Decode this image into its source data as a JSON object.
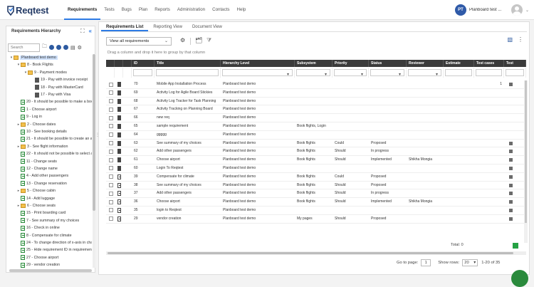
{
  "app": {
    "logo_text": "Reqtest"
  },
  "nav": [
    "Requirements",
    "Tests",
    "Bugs",
    "Plan",
    "Reports",
    "Administration",
    "Contacts",
    "Help"
  ],
  "nav_active": 0,
  "user": {
    "initials": "PT",
    "name": "Planboard test ...",
    "chevron": "⌄"
  },
  "left_panel": {
    "title": "Requirements Hierarchy",
    "search_placeholder": "Search",
    "tree": [
      {
        "depth": 0,
        "icon": "folder",
        "toggle": "▾",
        "text": "Planboard test demo",
        "selected": true
      },
      {
        "depth": 1,
        "icon": "folder",
        "toggle": "▾",
        "text": "8 - Book Flights"
      },
      {
        "depth": 2,
        "icon": "folder",
        "toggle": "▾",
        "text": "9 - Payment modes"
      },
      {
        "depth": 3,
        "icon": "doc",
        "toggle": "",
        "text": "19 - Pay with invoice receipt"
      },
      {
        "depth": 3,
        "icon": "doc",
        "toggle": "",
        "text": "18 - Pay with MasterCard"
      },
      {
        "depth": 3,
        "icon": "doc",
        "toggle": "",
        "text": "17 - Pay with Visa"
      },
      {
        "depth": 1,
        "icon": "file",
        "toggle": "",
        "text": "20 - It should be possible to make a booking"
      },
      {
        "depth": 1,
        "icon": "file",
        "toggle": "",
        "text": "1 - Choose airport"
      },
      {
        "depth": 1,
        "icon": "file",
        "toggle": "",
        "text": "9 - Log in"
      },
      {
        "depth": 1,
        "icon": "folder",
        "toggle": "▸",
        "text": "2 - Choose dates"
      },
      {
        "depth": 1,
        "icon": "file",
        "toggle": "",
        "text": "10 - See booking details"
      },
      {
        "depth": 1,
        "icon": "file",
        "toggle": "",
        "text": "21 - It should be possible to create an account"
      },
      {
        "depth": 1,
        "icon": "folder",
        "toggle": "▸",
        "text": "3 - See flight information"
      },
      {
        "depth": 1,
        "icon": "file",
        "toggle": "",
        "text": "22 - It should not be possible to select a seat"
      },
      {
        "depth": 1,
        "icon": "file",
        "toggle": "",
        "text": "11 - Change seats"
      },
      {
        "depth": 1,
        "icon": "file",
        "toggle": "",
        "text": "12 - Change name"
      },
      {
        "depth": 1,
        "icon": "file",
        "toggle": "",
        "text": "4 - Add other passengers"
      },
      {
        "depth": 1,
        "icon": "file",
        "toggle": "",
        "text": "13 - Change reservation"
      },
      {
        "depth": 1,
        "icon": "folder",
        "toggle": "▸",
        "text": "5 - Choose cabin"
      },
      {
        "depth": 1,
        "icon": "file",
        "toggle": "",
        "text": "14 - Add luggage"
      },
      {
        "depth": 1,
        "icon": "folder",
        "toggle": "▸",
        "text": "6 - Choose seats"
      },
      {
        "depth": 1,
        "icon": "file",
        "toggle": "",
        "text": "15 - Print boarding card"
      },
      {
        "depth": 1,
        "icon": "file",
        "toggle": "",
        "text": "7 - See summary of my choices"
      },
      {
        "depth": 1,
        "icon": "file",
        "toggle": "",
        "text": "16 - Check in online"
      },
      {
        "depth": 1,
        "icon": "file",
        "toggle": "",
        "text": "8 - Compensate for climate"
      },
      {
        "depth": 1,
        "icon": "file",
        "toggle": "",
        "text": "24 - To change direction of x-axis in chart"
      },
      {
        "depth": 1,
        "icon": "file",
        "toggle": "",
        "text": "25 - Hide requirement ID in requirement list"
      },
      {
        "depth": 1,
        "icon": "file",
        "toggle": "",
        "text": "27 - Choose airport"
      },
      {
        "depth": 1,
        "icon": "file",
        "toggle": "",
        "text": "29 - vendor creation"
      }
    ]
  },
  "tabs": [
    "Requirements List",
    "Reporting View",
    "Document View"
  ],
  "tabs_active": 0,
  "toolbar": {
    "view_select": "View all requirements",
    "group_hint": "Drag a column and drop it here to group by that column"
  },
  "table": {
    "headers": [
      "",
      "",
      "",
      "ID",
      "Title",
      "Hierarchy Level",
      "Subsystem",
      "Priority",
      "Status",
      "Reviewer",
      "Estimate",
      "Test cases",
      "Test"
    ],
    "rows": [
      {
        "id": "70",
        "title": "Mobile App Installation Process",
        "level": "Planboard test demo",
        "subsystem": "",
        "priority": "",
        "status": "",
        "reviewer": "",
        "tc": "1",
        "tcbox": true,
        "type": "doc"
      },
      {
        "id": "69",
        "title": "Activity Log for Agile Board Stickies",
        "level": "Planboard test demo",
        "subsystem": "",
        "priority": "",
        "status": "",
        "reviewer": "",
        "tc": "",
        "tcbox": false,
        "type": "doc"
      },
      {
        "id": "68",
        "title": "Activity Log Tracker for Task Planning",
        "level": "Planboard test demo",
        "subsystem": "",
        "priority": "",
        "status": "",
        "reviewer": "",
        "tc": "",
        "tcbox": false,
        "type": "doc"
      },
      {
        "id": "67",
        "title": "Activity Tracking on Planning Board",
        "level": "Planboard test demo",
        "subsystem": "",
        "priority": "",
        "status": "",
        "reviewer": "",
        "tc": "",
        "tcbox": false,
        "type": "doc"
      },
      {
        "id": "66",
        "title": "new req",
        "level": "Planboard test demo",
        "subsystem": "",
        "priority": "",
        "status": "",
        "reviewer": "",
        "tc": "",
        "tcbox": false,
        "type": "doc"
      },
      {
        "id": "65",
        "title": "sample requirement",
        "level": "Planboard test demo",
        "subsystem": "Book flights, Login",
        "priority": "",
        "status": "",
        "reviewer": "",
        "tc": "",
        "tcbox": false,
        "type": "doc"
      },
      {
        "id": "64",
        "title": "ggggg",
        "level": "Planboard test demo",
        "subsystem": "",
        "priority": "",
        "status": "",
        "reviewer": "",
        "tc": "",
        "tcbox": false,
        "type": "doc"
      },
      {
        "id": "63",
        "title": "See summary of my choices",
        "level": "Planboard test demo",
        "subsystem": "Book flights",
        "priority": "Could",
        "status": "Proposed",
        "reviewer": "",
        "tc": "",
        "tcbox": true,
        "type": "doc"
      },
      {
        "id": "62",
        "title": "Add other passengers",
        "level": "Planboard test demo",
        "subsystem": "Book flights",
        "priority": "Should",
        "status": "In progress",
        "reviewer": "",
        "tc": "",
        "tcbox": true,
        "type": "doc"
      },
      {
        "id": "61",
        "title": "Choose airport",
        "level": "Planboard test demo",
        "subsystem": "Book flights",
        "priority": "Should",
        "status": "Implemented",
        "reviewer": "Shikha Mongia",
        "tc": "",
        "tcbox": true,
        "type": "doc"
      },
      {
        "id": "60",
        "title": "Login To Reqtest",
        "level": "Planboard test demo",
        "subsystem": "",
        "priority": "",
        "status": "",
        "reviewer": "",
        "tc": "",
        "tcbox": true,
        "type": "doc"
      },
      {
        "id": "39",
        "title": "Compensate for climate",
        "level": "Planboard test demo",
        "subsystem": "Book flights",
        "priority": "Could",
        "status": "Proposed",
        "reviewer": "",
        "tc": "",
        "tcbox": true,
        "type": "tc"
      },
      {
        "id": "38",
        "title": "See summary of my choices",
        "level": "Planboard test demo",
        "subsystem": "Book flights",
        "priority": "Should",
        "status": "Proposed",
        "reviewer": "",
        "tc": "",
        "tcbox": true,
        "type": "tc"
      },
      {
        "id": "37",
        "title": "Add other passengers",
        "level": "Planboard test demo",
        "subsystem": "Book flights",
        "priority": "Should",
        "status": "In progress",
        "reviewer": "",
        "tc": "",
        "tcbox": true,
        "type": "tc"
      },
      {
        "id": "36",
        "title": "Choose airport",
        "level": "Planboard test demo",
        "subsystem": "Book flights",
        "priority": "Should",
        "status": "Implemented",
        "reviewer": "Shikha Mongia",
        "tc": "",
        "tcbox": true,
        "type": "tc"
      },
      {
        "id": "35",
        "title": "login to Reqtest",
        "level": "Planboard test demo",
        "subsystem": "",
        "priority": "",
        "status": "",
        "reviewer": "",
        "tc": "",
        "tcbox": true,
        "type": "tc"
      },
      {
        "id": "29",
        "title": "vendor creation",
        "level": "Planboard test demo",
        "subsystem": "My pages",
        "priority": "Should",
        "status": "Proposed",
        "reviewer": "",
        "tc": "",
        "tcbox": true,
        "type": "tc"
      }
    ],
    "total": "Total: 0"
  },
  "pager": {
    "goto_label": "Go to page:",
    "page": "1",
    "show_label": "Show rows:",
    "rows": "20",
    "range": "1-20 of 35"
  },
  "colors": {
    "accent": "#2d7be5",
    "brand": "#243b66",
    "green": "#25a244",
    "header_bg": "#3a3a3a"
  },
  "icons": [
    "logo-icon",
    "fullscreen-icon",
    "collapse-icon",
    "add-icon",
    "remove-icon",
    "move-icon",
    "export-icon",
    "gear-icon",
    "import-icon",
    "filter-icon",
    "excel-icon",
    "more-icon"
  ]
}
